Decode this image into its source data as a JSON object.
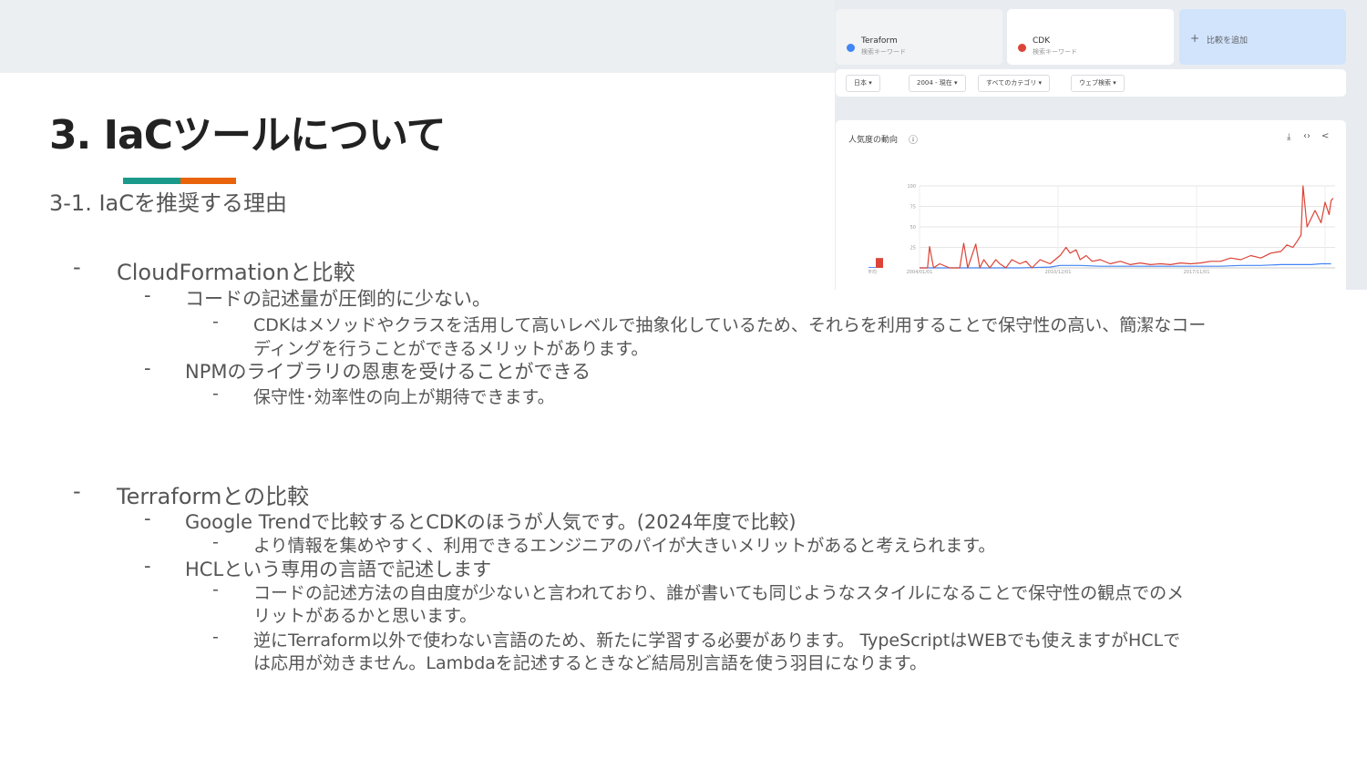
{
  "slide": {
    "title": "3. IaCツールについて",
    "subtitle": "3-1. IaCを推奨する理由",
    "accent_colors": [
      "#1a9a8a",
      "#e8630a"
    ]
  },
  "bullets": {
    "dash": "-",
    "cf": {
      "heading": "CloudFormationと比較",
      "point1": "コードの記述量が圧倒的に少ない。",
      "point1_detail_line1": "CDKはメソッドやクラスを活用して高いレベルで抽象化しているため、それらを利用することで保守性の高い、簡潔なコー",
      "point1_detail_line2": "ディングを行うことができるメリットがあります。",
      "point2": "NPMのライブラリの恩恵を受けることができる",
      "point2_detail": "保守性･効率性の向上が期待できます。"
    },
    "tf": {
      "heading": "Terraformとの比較",
      "point1": "Google Trendで比較するとCDKのほうが人気です。(2024年度で比較)",
      "point1_detail": "より情報を集めやすく、利用できるエンジニアのパイが大きいメリットがあると考えられます。",
      "point2": "HCLという専用の言語で記述します",
      "point2_detail1_line1": "コードの記述方法の自由度が少ないと言われており、誰が書いても同じようなスタイルになることで保守性の観点でのメ",
      "point2_detail1_line2": "リットがあるかと思います。",
      "point2_detail2_line1": "逆にTerraform以外で使わない言語のため、新たに学習する必要があります。 TypeScriptはWEBでも使えますがHCLで",
      "point2_detail2_line2": "は応用が効きません。Lambdaを記述するときなど結局別言語を使う羽目になります。"
    }
  },
  "trends": {
    "keywords": [
      {
        "name": "Teraform",
        "sub": "検索キーワード",
        "color": "#4285f4"
      },
      {
        "name": "CDK",
        "sub": "検索キーワード",
        "color": "#db4437"
      }
    ],
    "add_label": "比較を追加",
    "filters": [
      "日本",
      "2004 - 現在",
      "すべてのカテゴリ",
      "ウェブ検索"
    ],
    "chart_title": "人気度の動向",
    "help_icon": "help-circle-icon",
    "actions": [
      "download-icon",
      "embed-icon",
      "share-icon"
    ]
  },
  "chart_data": {
    "type": "line",
    "title": "人気度の動向",
    "ylim": [
      0,
      100
    ],
    "yticks": [
      "100",
      "75",
      "50",
      "25"
    ],
    "xticks": [
      "2004/01/01",
      "2010/12/01",
      "2017/11/01"
    ],
    "average_label": "平均",
    "grid": true,
    "series": [
      {
        "name": "Teraform",
        "color": "#4285f4",
        "average": 1,
        "x": [
          2004.0,
          2009.0,
          2010.5,
          2011.0,
          2012.0,
          2013.0,
          2014.0,
          2015.0,
          2016.0,
          2017.0,
          2018.0,
          2019.0,
          2020.0,
          2021.0,
          2022.0,
          2023.0,
          2023.5,
          2024.0,
          2024.5
        ],
        "values": [
          0,
          0,
          1,
          3,
          3,
          2,
          2,
          2,
          2,
          2,
          2,
          2,
          3,
          3,
          4,
          4,
          4,
          5,
          5
        ]
      },
      {
        "name": "CDK",
        "color": "#db4437",
        "average": 12,
        "x": [
          2004.0,
          2004.4,
          2004.5,
          2004.7,
          2005.0,
          2005.5,
          2006.0,
          2006.2,
          2006.4,
          2006.8,
          2007.0,
          2007.2,
          2007.5,
          2007.8,
          2008.0,
          2008.3,
          2008.6,
          2009.0,
          2009.3,
          2009.6,
          2010.0,
          2010.5,
          2011.0,
          2011.3,
          2011.5,
          2011.8,
          2012.0,
          2012.3,
          2012.6,
          2013.0,
          2013.5,
          2014.0,
          2014.5,
          2015.0,
          2015.5,
          2016.0,
          2016.5,
          2017.0,
          2017.5,
          2018.0,
          2018.5,
          2019.0,
          2019.5,
          2020.0,
          2020.5,
          2021.0,
          2021.5,
          2022.0,
          2022.3,
          2022.6,
          2022.8,
          2023.0,
          2023.1,
          2023.3,
          2023.5,
          2023.7,
          2023.9,
          2024.0,
          2024.2,
          2024.4,
          2024.5,
          2024.6
        ],
        "values": [
          0,
          0,
          26,
          0,
          5,
          0,
          0,
          30,
          0,
          29,
          0,
          10,
          0,
          10,
          5,
          0,
          10,
          5,
          8,
          0,
          10,
          5,
          15,
          25,
          18,
          22,
          10,
          15,
          8,
          10,
          5,
          8,
          4,
          6,
          4,
          5,
          4,
          6,
          5,
          6,
          8,
          8,
          12,
          10,
          15,
          12,
          18,
          20,
          28,
          25,
          32,
          40,
          100,
          50,
          60,
          70,
          60,
          55,
          80,
          65,
          82,
          85
        ]
      }
    ]
  }
}
